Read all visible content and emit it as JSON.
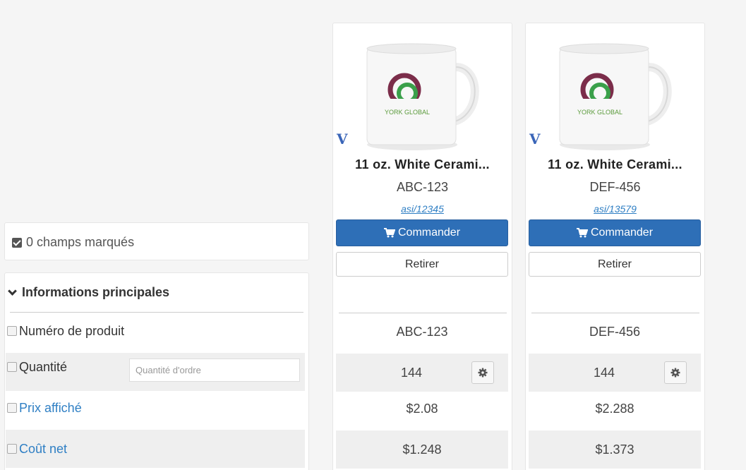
{
  "marked": {
    "label": "0 champs marqués"
  },
  "section": {
    "title": "Informations principales"
  },
  "fields": {
    "product_number": "Numéro de produit",
    "quantity": "Quantité",
    "quantity_placeholder": "Quantité d'ordre",
    "displayed_price": "Prix affiché",
    "net_cost": "Coût net"
  },
  "products": [
    {
      "name": "11 oz. White Cerami...",
      "code": "ABC-123",
      "asi": "asi/12345",
      "brand": "YORK GLOBAL",
      "order_label": "Commander",
      "remove_label": "Retirer",
      "product_number": "ABC-123",
      "quantity": "144",
      "displayed_price": "$2.08",
      "net_cost": "$1.248"
    },
    {
      "name": "11 oz. White Cerami...",
      "code": "DEF-456",
      "asi": "asi/13579",
      "brand": "YORK GLOBAL",
      "order_label": "Commander",
      "remove_label": "Retirer",
      "product_number": "DEF-456",
      "quantity": "144",
      "displayed_price": "$2.288",
      "net_cost": "$1.373"
    }
  ],
  "colors": {
    "primary": "#2e6fb7",
    "link": "#2f7fc4",
    "logo_maroon": "#7b2d4a",
    "logo_green": "#3aa04a"
  },
  "icons": {
    "cart": "cart-icon",
    "gear": "gear-icon",
    "chevron": "chevron-down-icon",
    "checkbox": "checkbox-icon"
  }
}
